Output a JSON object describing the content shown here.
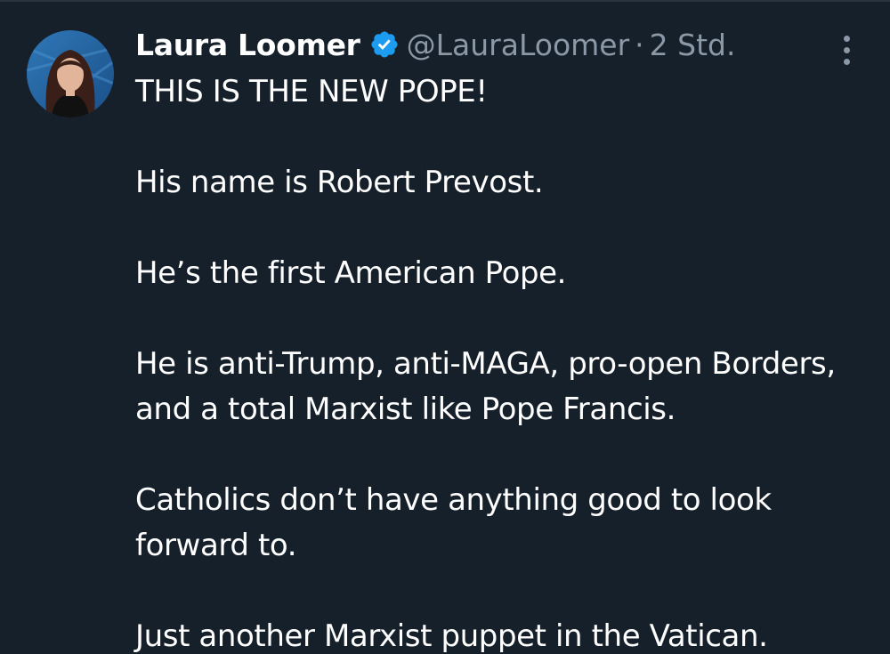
{
  "tweet": {
    "author": {
      "display_name": "Laura Loomer",
      "handle": "@LauraLoomer",
      "verified": true
    },
    "separator": "·",
    "timestamp": "2 Std.",
    "more_icon": "more-vertical-icon",
    "paragraphs": [
      "THIS IS THE NEW POPE!",
      "His name is Robert Prevost.",
      "He’s the first American Pope.",
      "He is anti-Trump, anti-MAGA, pro-open Borders, and a total Marxist like Pope Francis.",
      "Catholics don’t have anything good to look forward to.",
      "Just another Marxist puppet in the Vatican."
    ]
  },
  "colors": {
    "background": "#16202b",
    "primary_text": "#ffffff",
    "secondary_text": "#8b98a5",
    "verified_badge": "#1d9bf0"
  }
}
